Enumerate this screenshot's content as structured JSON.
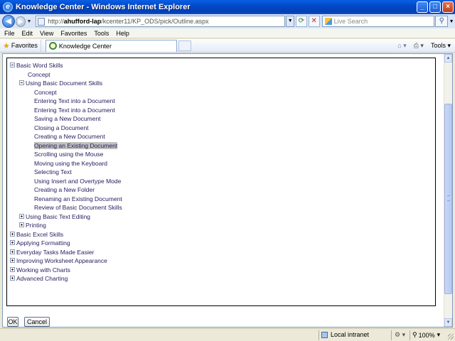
{
  "window": {
    "title": "Knowledge Center - Windows Internet Explorer",
    "minimize_label": "_",
    "maximize_label": "□",
    "close_label": "×"
  },
  "address": {
    "url_prefix": "http://",
    "url_host": "ahufford-lap",
    "url_path": "/kcenter11/KP_ODS/pick/Outline.aspx",
    "search_placeholder": "Live Search"
  },
  "menu": [
    "File",
    "Edit",
    "View",
    "Favorites",
    "Tools",
    "Help"
  ],
  "favbar": {
    "favorites_label": "Favorites",
    "tab_label": "Knowledge Center",
    "tools_label": "Tools"
  },
  "outline": [
    {
      "label": "Basic Word Skills",
      "level": 0,
      "toggle": "minus"
    },
    {
      "label": "Concept",
      "level": 1,
      "toggle": "none"
    },
    {
      "label": "Using Basic Document Skills",
      "level": 1,
      "toggle": "minus"
    },
    {
      "label": "Concept",
      "level": 2,
      "toggle": "none"
    },
    {
      "label": "Entering Text into a Document",
      "level": 2,
      "toggle": "none"
    },
    {
      "label": "Entering Text into a Document",
      "level": 2,
      "toggle": "none"
    },
    {
      "label": "Saving a New Document",
      "level": 2,
      "toggle": "none"
    },
    {
      "label": "Closing a Document",
      "level": 2,
      "toggle": "none"
    },
    {
      "label": "Creating a New Document",
      "level": 2,
      "toggle": "none"
    },
    {
      "label": "Opening an Existing Document",
      "level": 2,
      "toggle": "none",
      "selected": true
    },
    {
      "label": "Scrolling using the Mouse",
      "level": 2,
      "toggle": "none"
    },
    {
      "label": "Moving using the Keyboard",
      "level": 2,
      "toggle": "none"
    },
    {
      "label": "Selecting Text",
      "level": 2,
      "toggle": "none"
    },
    {
      "label": "Using Insert and Overtype Mode",
      "level": 2,
      "toggle": "none"
    },
    {
      "label": "Creating a New Folder",
      "level": 2,
      "toggle": "none"
    },
    {
      "label": "Renaming an Existing Document",
      "level": 2,
      "toggle": "none"
    },
    {
      "label": "Review of Basic Document Skills",
      "level": 2,
      "toggle": "none"
    },
    {
      "label": "Using Basic Text Editing",
      "level": 1,
      "toggle": "plus"
    },
    {
      "label": "Printing",
      "level": 1,
      "toggle": "plus"
    },
    {
      "label": "Basic Excel Skills",
      "level": 0,
      "toggle": "plus"
    },
    {
      "label": "Applying Formatting",
      "level": 0,
      "toggle": "plus"
    },
    {
      "label": "Everyday Tasks Made Easier",
      "level": 0,
      "toggle": "plus"
    },
    {
      "label": "Improving Worksheet Appearance",
      "level": 0,
      "toggle": "plus"
    },
    {
      "label": "Working with Charts",
      "level": 0,
      "toggle": "plus"
    },
    {
      "label": "Advanced Charting",
      "level": 0,
      "toggle": "plus"
    }
  ],
  "buttons": {
    "ok": "OK",
    "cancel": "Cancel"
  },
  "status": {
    "zone": "Local intranet",
    "zoom": "100%"
  },
  "colors": {
    "link_text": "#2a2060",
    "selected_bg": "#c0c0c0",
    "titlebar": "#0348c7"
  }
}
